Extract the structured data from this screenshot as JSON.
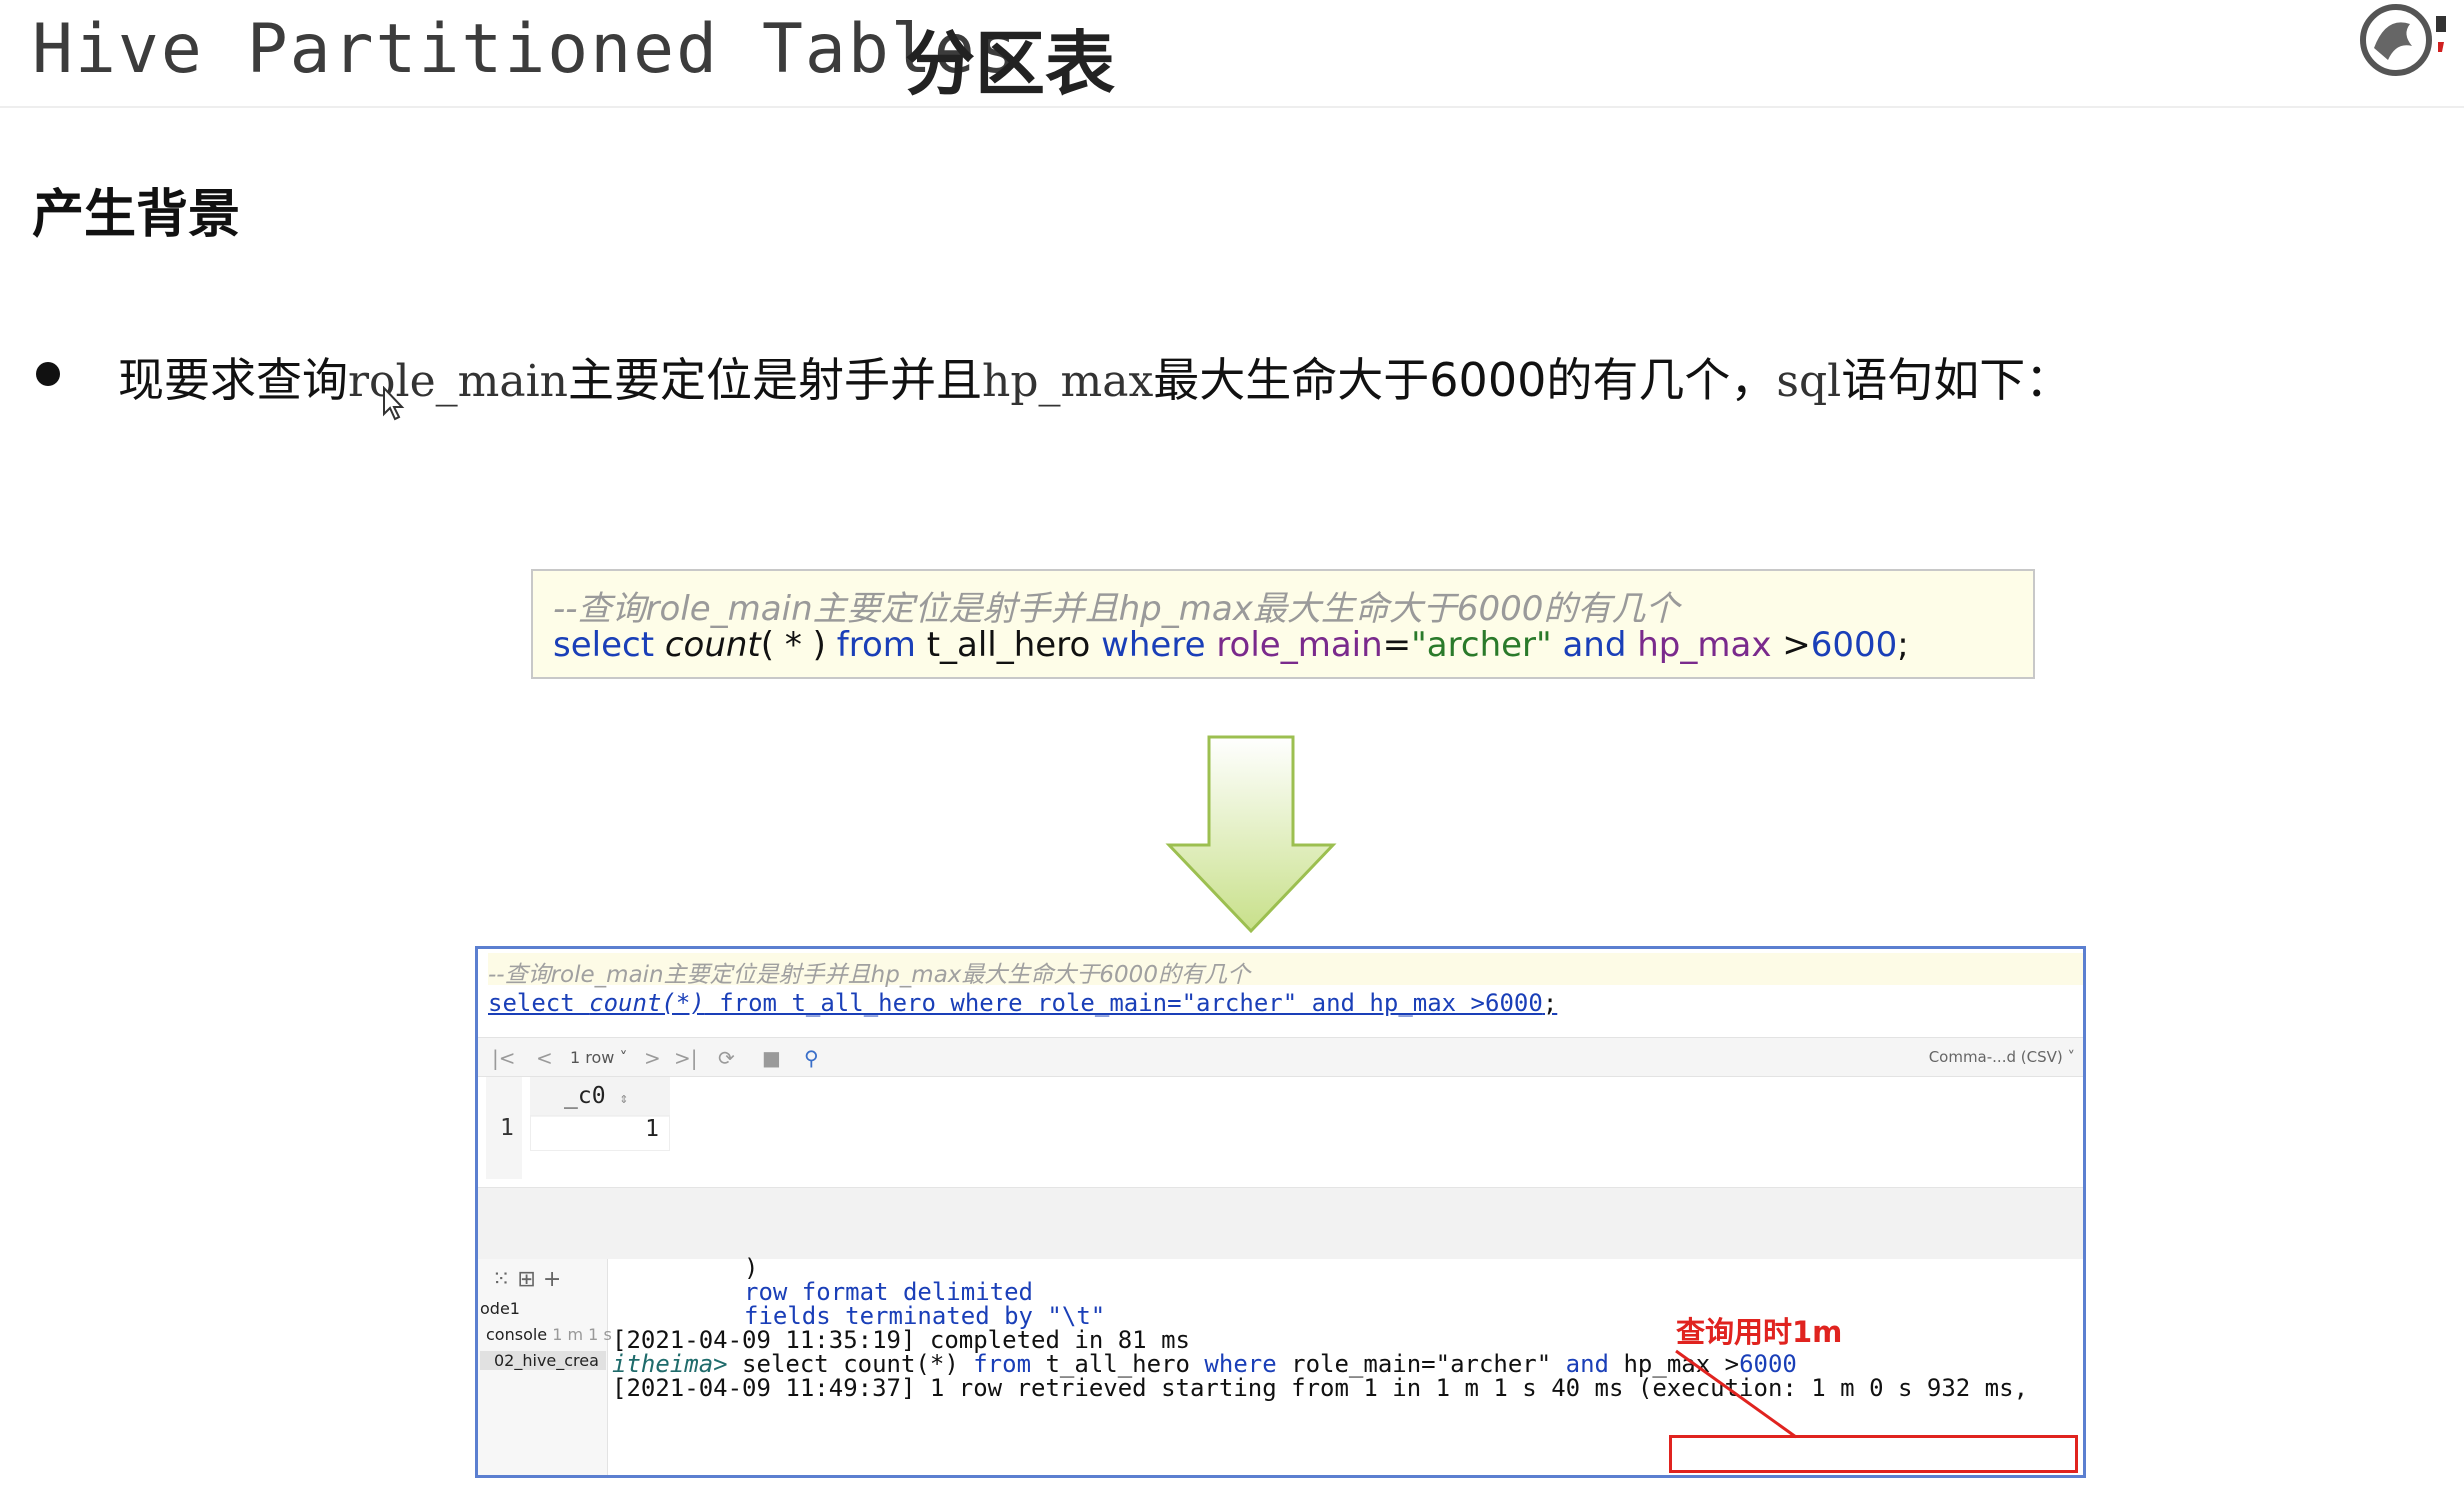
{
  "slide": {
    "title_en": "Hive Partitioned Tables",
    "title_cn": "分区表",
    "section_heading": "产生背景",
    "bullet": {
      "part1": "现要求查询",
      "code1": "role_main",
      "part2": "主要定位是射手并且",
      "code2": "hp_max",
      "part3": "最大生命大于6000的有几个，",
      "code3": "sql",
      "part4": "语句如下："
    }
  },
  "code_box": {
    "comment": "--查询role_main主要定位是射手并且hp_max最大生命大于6000的有几个",
    "sql": {
      "select": "select",
      "count": "count",
      "count_args": "( * )",
      "from": "from",
      "table": "t_all_hero",
      "where": "where",
      "col1": "role_main",
      "eq": "=",
      "val1": "\"archer\"",
      "and": "and",
      "col2": "hp_max",
      "gt": " >",
      "val2": "6000",
      "semi": ";"
    }
  },
  "ide": {
    "editor": {
      "comment": "--查询role_main主要定位是射手并且hp_max最大生命大于6000的有几个",
      "sql_a": "select ",
      "sql_count": "count(*)",
      "sql_b": " from t_all_hero where role_main=\"archer\" and hp_max >6000",
      "sql_semi": ";"
    },
    "toolbar": {
      "first": "|<",
      "prev": "<",
      "rows": "1 row ˅",
      "next": ">",
      "last": ">|",
      "refresh": "⟳",
      "stop": "■",
      "pin": "⚲",
      "export": "Comma-...d (CSV) ˅"
    },
    "grid": {
      "column": "_c0",
      "sort_icon": "⇕",
      "row_number": "1",
      "cell_value": "1"
    },
    "side": {
      "icons": "⁙  ⊞  +",
      "item1": "ode1",
      "item2_name": "console",
      "item2_meta": "1 m 1 s",
      "item3": "02_hive_crea"
    },
    "console": {
      "line1": ")",
      "line2": "row format delimited",
      "line3": "fields terminated by \"\\t\"",
      "line4": "[2021-04-09 11:35:19] completed in 81 ms",
      "prompt": "itheima>",
      "line5_a": " select count(*) ",
      "line5_from": "from",
      "line5_b": " t_all_hero ",
      "line5_where": "where",
      "line5_c": " role_main=\"archer\" ",
      "line5_and": "and",
      "line5_d": " hp_max >",
      "line5_num": "6000",
      "line6": "[2021-04-09 11:49:37] 1 row retrieved starting from 1 in 1 m 1 s 40 ms (execution: 1 m 0 s 932 ms,"
    },
    "annotation": "查询用时1m"
  },
  "colors": {
    "keyword": "#1a3fb8",
    "column": "#7a2a8c",
    "string": "#2a7a2a",
    "annotation": "#e0231f",
    "arrow_fill": "#c8e08a"
  }
}
